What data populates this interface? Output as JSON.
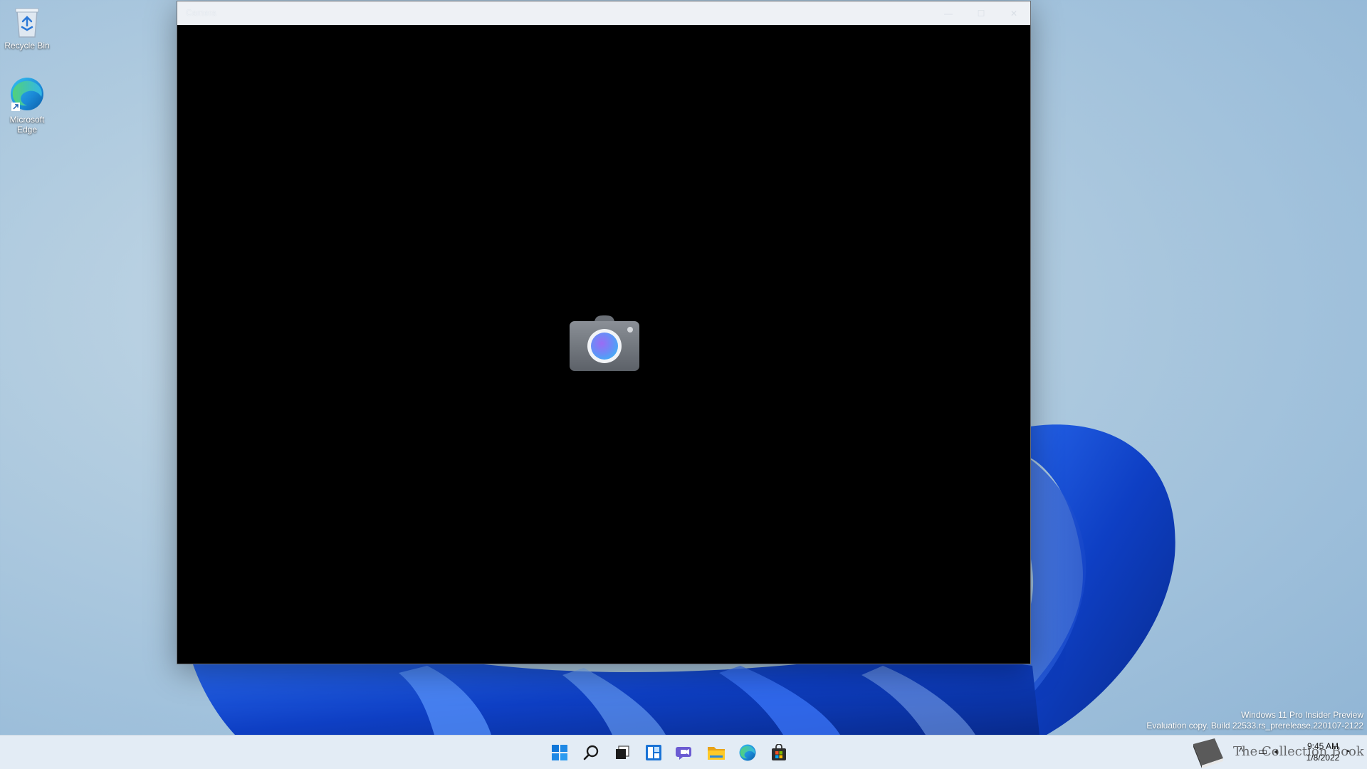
{
  "desktop": {
    "icons": [
      {
        "label": "Recycle Bin",
        "icon": "recycle-bin-icon"
      },
      {
        "label": "Microsoft Edge",
        "icon": "edge-icon"
      }
    ]
  },
  "window": {
    "title": "Camera",
    "controls": {
      "minimize": "—",
      "maximize": "☐",
      "close": "✕"
    },
    "center_icon": "camera-icon"
  },
  "watermark": {
    "line1": "Windows 11 Pro Insider Preview",
    "line2": "Evaluation copy. Build 22533.rs_prerelease.220107-2122"
  },
  "taskbar": {
    "apps": [
      "start-icon",
      "search-icon",
      "task-view-icon",
      "widgets-icon",
      "chat-icon",
      "file-explorer-icon",
      "edge-icon",
      "store-icon"
    ],
    "tray": {
      "chevron": "^",
      "time": "9:45 AM",
      "date": "1/8/2022",
      "overlay_text": "The Collection Book"
    }
  },
  "colors": {
    "wallpaper": "#a9c6de",
    "bloom": "#1a4fd6",
    "taskbar": "#e3ecf5",
    "window_title": "#eef1f5",
    "viewport": "#000000"
  }
}
